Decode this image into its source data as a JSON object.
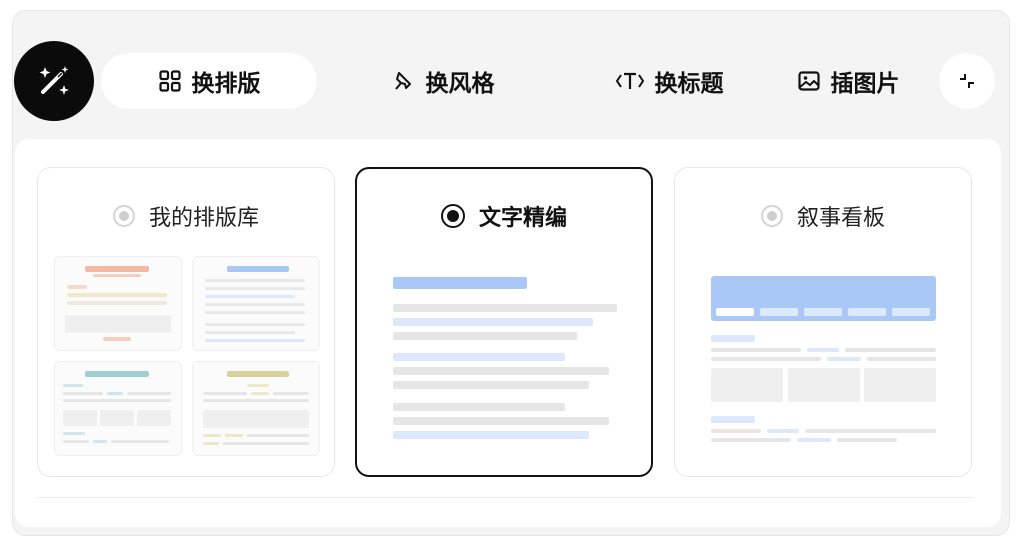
{
  "toolbar": {
    "magic_icon": "magic-wand-icon",
    "tabs": [
      {
        "label": "换排版",
        "icon": "layout-grid-icon",
        "active": true
      },
      {
        "label": "换风格",
        "icon": "style-brush-icon",
        "active": false
      },
      {
        "label": "换标题",
        "icon": "title-text-icon",
        "active": false
      },
      {
        "label": "插图片",
        "icon": "image-icon",
        "active": false
      }
    ],
    "collapse_icon": "collapse-icon"
  },
  "options": [
    {
      "label": "我的排版库",
      "selected": false
    },
    {
      "label": "文字精编",
      "selected": true
    },
    {
      "label": "叙事看板",
      "selected": false
    }
  ],
  "colors": {
    "accent_dark": "#111111",
    "blue_bar": "#a9c8f5",
    "light_blue_bar": "#dce8fb",
    "gray_bar": "#e6e6e6",
    "salmon": "#f6b8a4",
    "teal": "#9fcfd6",
    "olive": "#d9d39a"
  }
}
